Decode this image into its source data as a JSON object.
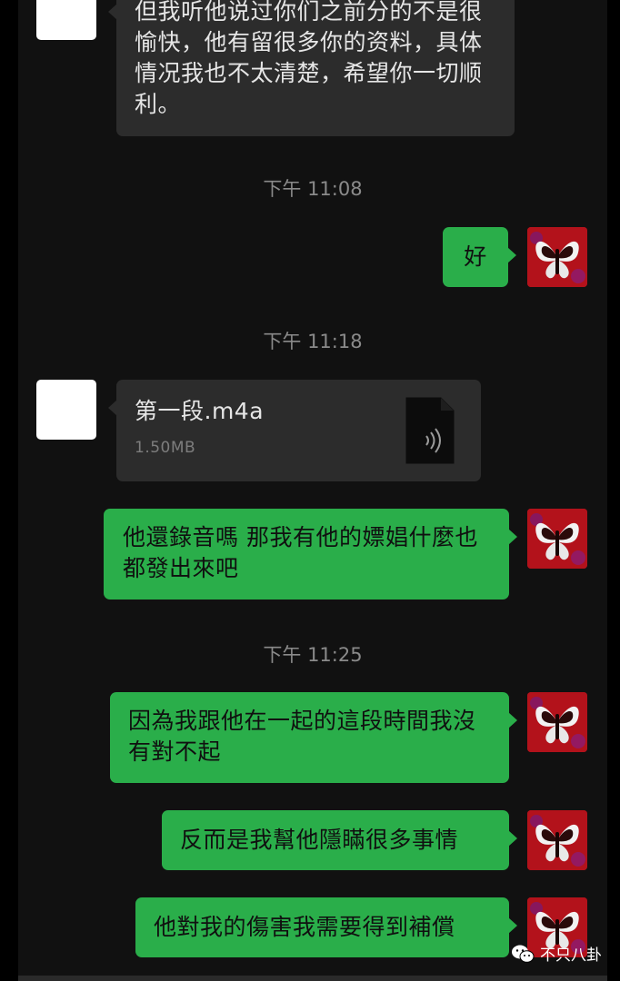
{
  "messages": {
    "m1": {
      "text": "但我听他说过你们之前分的不是很愉快，他有留很多你的资料，具体情况我也不太清楚，希望你一切顺利。"
    },
    "t1": "下午 11:08",
    "m2": {
      "text": "好"
    },
    "t2": "下午 11:18",
    "file": {
      "name": "第一段.m4a",
      "size": "1.50MB"
    },
    "m3": {
      "text": "他還錄音嗎 那我有他的嫖娼什麼也都發出來吧"
    },
    "t3": "下午 11:25",
    "m4": {
      "text": "因為我跟他在一起的這段時間我沒有對不起"
    },
    "m5": {
      "text": "反而是我幫他隱瞞很多事情"
    },
    "m6": {
      "text": "他對我的傷害我需要得到補償"
    }
  },
  "watermark": {
    "text": "不只八卦",
    "icon": "wechat-icon"
  },
  "colors": {
    "outgoing_bubble": "#2aae4a",
    "incoming_bubble": "#2c2c2c",
    "chat_background": "#111111",
    "timestamp": "#8a8a8a"
  }
}
